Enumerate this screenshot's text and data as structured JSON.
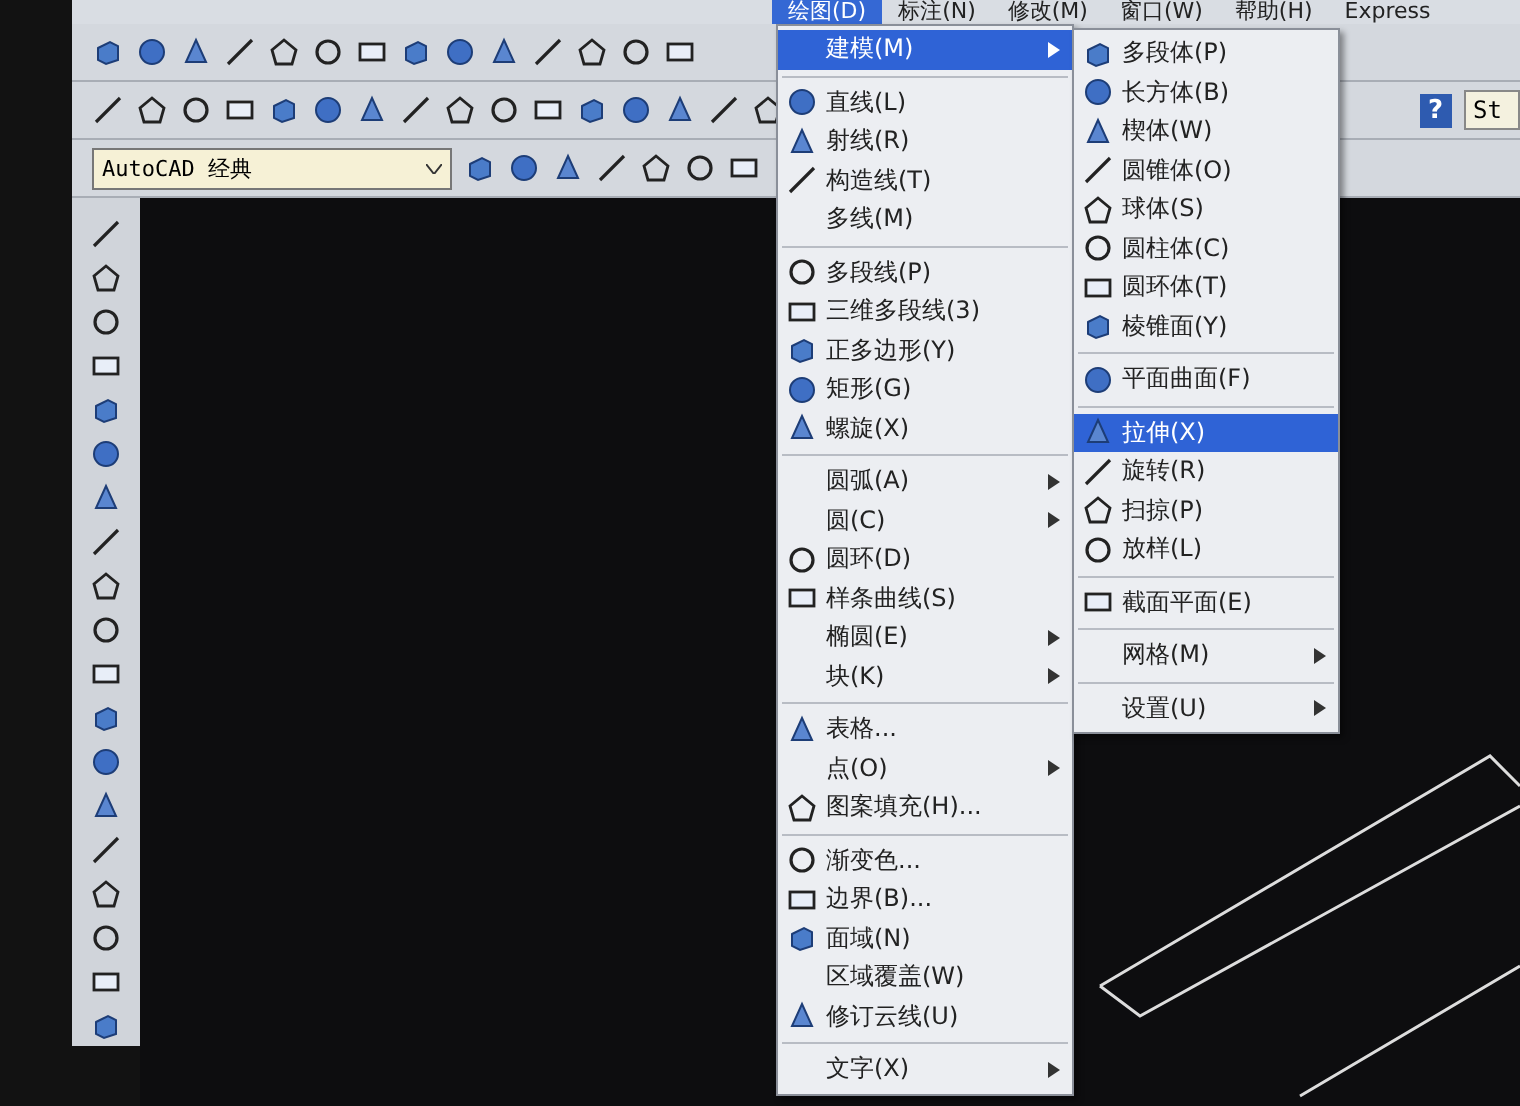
{
  "menu_bar": [
    {
      "label": "绘图(D)",
      "selected": true
    },
    {
      "label": "标注(N)",
      "selected": false
    },
    {
      "label": "修改(M)",
      "selected": false
    },
    {
      "label": "窗口(W)",
      "selected": false
    },
    {
      "label": "帮助(H)",
      "selected": false
    },
    {
      "label": "Express",
      "selected": false
    }
  ],
  "workspace_combo": {
    "value": "AutoCAD 经典"
  },
  "help_button": {
    "label": "?"
  },
  "text_style_field": {
    "value": "St"
  },
  "draw_menu": [
    {
      "kind": "item",
      "label": "建模(M)",
      "icon": false,
      "submenu": true,
      "selected": true
    },
    {
      "kind": "separator"
    },
    {
      "kind": "item",
      "label": "直线(L)",
      "icon": true,
      "submenu": false,
      "selected": false
    },
    {
      "kind": "item",
      "label": "射线(R)",
      "icon": true,
      "submenu": false,
      "selected": false
    },
    {
      "kind": "item",
      "label": "构造线(T)",
      "icon": true,
      "submenu": false,
      "selected": false
    },
    {
      "kind": "item",
      "label": "多线(M)",
      "icon": false,
      "submenu": false,
      "selected": false
    },
    {
      "kind": "separator"
    },
    {
      "kind": "item",
      "label": "多段线(P)",
      "icon": true,
      "submenu": false,
      "selected": false
    },
    {
      "kind": "item",
      "label": "三维多段线(3)",
      "icon": true,
      "submenu": false,
      "selected": false
    },
    {
      "kind": "item",
      "label": "正多边形(Y)",
      "icon": true,
      "submenu": false,
      "selected": false
    },
    {
      "kind": "item",
      "label": "矩形(G)",
      "icon": true,
      "submenu": false,
      "selected": false
    },
    {
      "kind": "item",
      "label": "螺旋(X)",
      "icon": true,
      "submenu": false,
      "selected": false
    },
    {
      "kind": "separator"
    },
    {
      "kind": "item",
      "label": "圆弧(A)",
      "icon": false,
      "submenu": true,
      "selected": false
    },
    {
      "kind": "item",
      "label": "圆(C)",
      "icon": false,
      "submenu": true,
      "selected": false
    },
    {
      "kind": "item",
      "label": "圆环(D)",
      "icon": true,
      "submenu": false,
      "selected": false
    },
    {
      "kind": "item",
      "label": "样条曲线(S)",
      "icon": true,
      "submenu": false,
      "selected": false
    },
    {
      "kind": "item",
      "label": "椭圆(E)",
      "icon": false,
      "submenu": true,
      "selected": false
    },
    {
      "kind": "item",
      "label": "块(K)",
      "icon": false,
      "submenu": true,
      "selected": false
    },
    {
      "kind": "separator"
    },
    {
      "kind": "item",
      "label": "表格...",
      "icon": true,
      "submenu": false,
      "selected": false
    },
    {
      "kind": "item",
      "label": "点(O)",
      "icon": false,
      "submenu": true,
      "selected": false
    },
    {
      "kind": "item",
      "label": "图案填充(H)...",
      "icon": true,
      "submenu": false,
      "selected": false
    },
    {
      "kind": "separator"
    },
    {
      "kind": "item",
      "label": "渐变色...",
      "icon": true,
      "submenu": false,
      "selected": false
    },
    {
      "kind": "item",
      "label": "边界(B)...",
      "icon": true,
      "submenu": false,
      "selected": false
    },
    {
      "kind": "item",
      "label": "面域(N)",
      "icon": true,
      "submenu": false,
      "selected": false
    },
    {
      "kind": "item",
      "label": "区域覆盖(W)",
      "icon": false,
      "submenu": false,
      "selected": false
    },
    {
      "kind": "item",
      "label": "修订云线(U)",
      "icon": true,
      "submenu": false,
      "selected": false
    },
    {
      "kind": "separator"
    },
    {
      "kind": "item",
      "label": "文字(X)",
      "icon": false,
      "submenu": true,
      "selected": false
    }
  ],
  "modeling_submenu": [
    {
      "kind": "item",
      "label": "多段体(P)",
      "icon": true,
      "submenu": false,
      "selected": false
    },
    {
      "kind": "item",
      "label": "长方体(B)",
      "icon": true,
      "submenu": false,
      "selected": false
    },
    {
      "kind": "item",
      "label": "楔体(W)",
      "icon": true,
      "submenu": false,
      "selected": false
    },
    {
      "kind": "item",
      "label": "圆锥体(O)",
      "icon": true,
      "submenu": false,
      "selected": false
    },
    {
      "kind": "item",
      "label": "球体(S)",
      "icon": true,
      "submenu": false,
      "selected": false
    },
    {
      "kind": "item",
      "label": "圆柱体(C)",
      "icon": true,
      "submenu": false,
      "selected": false
    },
    {
      "kind": "item",
      "label": "圆环体(T)",
      "icon": true,
      "submenu": false,
      "selected": false
    },
    {
      "kind": "item",
      "label": "棱锥面(Y)",
      "icon": true,
      "submenu": false,
      "selected": false
    },
    {
      "kind": "separator"
    },
    {
      "kind": "item",
      "label": "平面曲面(F)",
      "icon": true,
      "submenu": false,
      "selected": false
    },
    {
      "kind": "separator"
    },
    {
      "kind": "item",
      "label": "拉伸(X)",
      "icon": true,
      "submenu": false,
      "selected": true
    },
    {
      "kind": "item",
      "label": "旋转(R)",
      "icon": true,
      "submenu": false,
      "selected": false
    },
    {
      "kind": "item",
      "label": "扫掠(P)",
      "icon": true,
      "submenu": false,
      "selected": false
    },
    {
      "kind": "item",
      "label": "放样(L)",
      "icon": true,
      "submenu": false,
      "selected": false
    },
    {
      "kind": "separator"
    },
    {
      "kind": "item",
      "label": "截面平面(E)",
      "icon": true,
      "submenu": false,
      "selected": false
    },
    {
      "kind": "separator"
    },
    {
      "kind": "item",
      "label": "网格(M)",
      "icon": false,
      "submenu": true,
      "selected": false
    },
    {
      "kind": "separator"
    },
    {
      "kind": "item",
      "label": "设置(U)",
      "icon": false,
      "submenu": true,
      "selected": false
    }
  ]
}
